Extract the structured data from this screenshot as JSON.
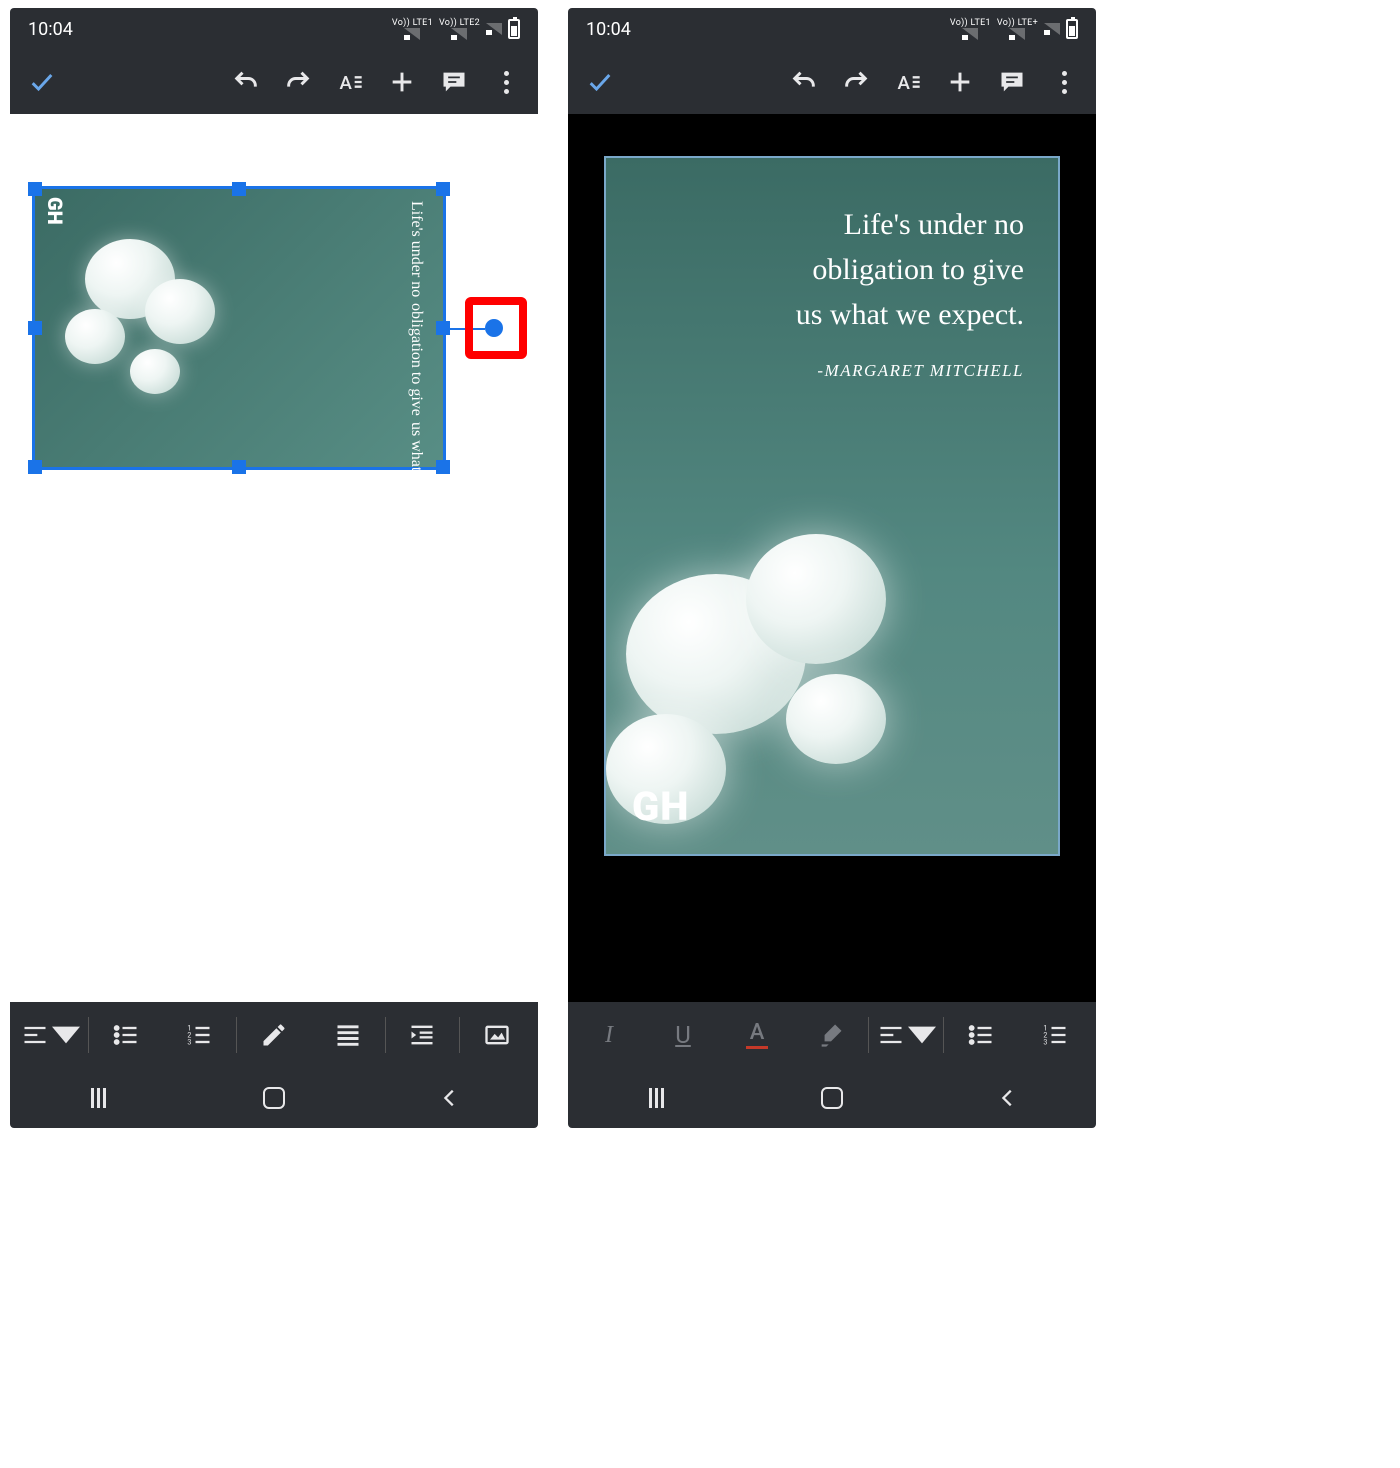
{
  "status": {
    "time": "10:04",
    "sim1": "Vo)) LTE1",
    "sim2": "Vo)) LTE2",
    "lte_plus": "Vo)) LTE+"
  },
  "toolbar": {
    "confirm": "✓",
    "undo": "Undo",
    "redo": "Redo",
    "text_format": "A",
    "add": "+",
    "comment": "Comment",
    "more": "More"
  },
  "image": {
    "quote_line1": "Life's under no",
    "quote_line2": "obligation to give",
    "quote_line3": "us what we expect.",
    "attribution": "-MARGARET MITCHELL",
    "watermark": "GH"
  },
  "formatbar_left": {
    "align": "align-left",
    "bullets": "bulleted-list",
    "numbers": "numbered-list",
    "edit": "pencil",
    "justify": "justify",
    "indent": "indent",
    "image": "insert-image"
  },
  "formatbar_right": {
    "italic": "I",
    "underline": "U",
    "textcolor": "A",
    "highlight": "highlighter",
    "align": "align-left",
    "bullets": "bulleted-list",
    "numbers": "numbered-list"
  },
  "nav": {
    "recent": "recents",
    "home": "home",
    "back": "back"
  },
  "annotation": {
    "rotation_handle": "rotation-handle-highlighted"
  }
}
